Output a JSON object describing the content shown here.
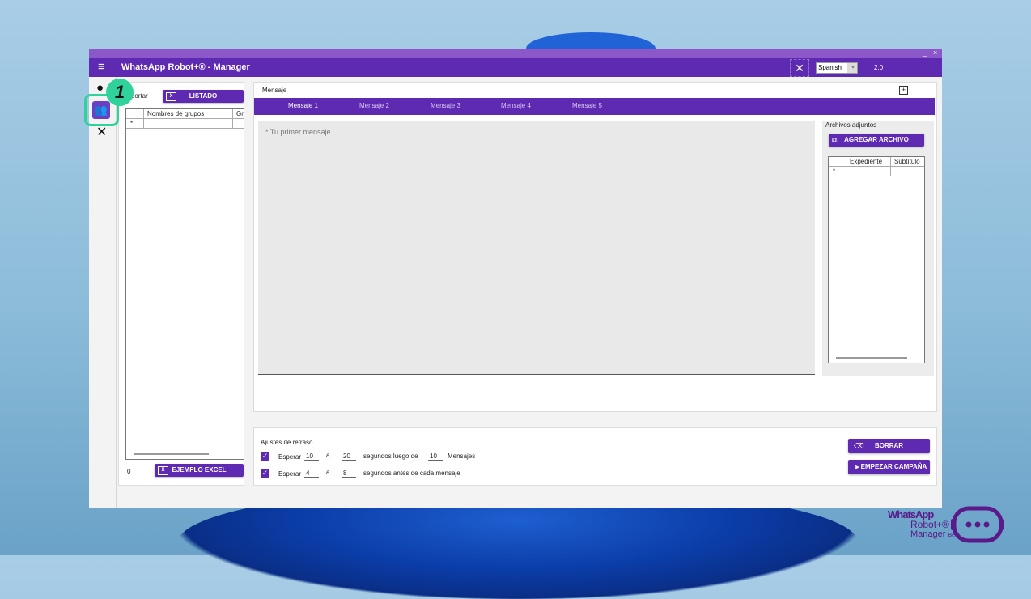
{
  "window": {
    "title": "WhatsApp Robot+® - Manager",
    "minimize": "_",
    "close": "×",
    "language": "Spanish",
    "version": "2.0"
  },
  "left_panel": {
    "import_label": "Importar",
    "list_button": "LISTADO",
    "column_groups": "Nombres de grupos",
    "column_cut": "Gr",
    "new_row_marker": "*",
    "count": "0",
    "example_button": "EJEMPLO EXCEL"
  },
  "message": {
    "title": "Mensaje",
    "add_label": "+",
    "tabs": [
      "Mensaje 1",
      "Mensaje 2",
      "Mensaje 3",
      "Mensaje 4",
      "Mensaje 5"
    ],
    "placeholder": "* Tu primer mensaje"
  },
  "attachments": {
    "title": "Archivos adjuntos",
    "add_button": "AGREGAR ARCHIVO",
    "col_file": "Expediente",
    "col_subtitle": "Subtítulo",
    "new_row_marker": "*"
  },
  "delay": {
    "title": "Ajustes de retraso",
    "row1": {
      "wait": "Esperar",
      "from": "10",
      "to_word": "a",
      "to": "20",
      "after": "segundos luego de",
      "count": "10",
      "unit": "Mensajes"
    },
    "row2": {
      "wait": "Esperar",
      "from": "4",
      "to_word": "a",
      "to": "8",
      "after": "segundos antes de cada mensaje"
    },
    "clear_button": "BORRAR",
    "start_button": "EMPEZAR CAMPAÑA"
  },
  "callout": {
    "number": "1"
  },
  "brand": {
    "line1": "WhatsApp",
    "line2": "Robot+®",
    "line3": "Manager",
    "beta": "Beta"
  },
  "colors": {
    "primary": "#5e2ab1",
    "accent": "#2fd29b"
  }
}
